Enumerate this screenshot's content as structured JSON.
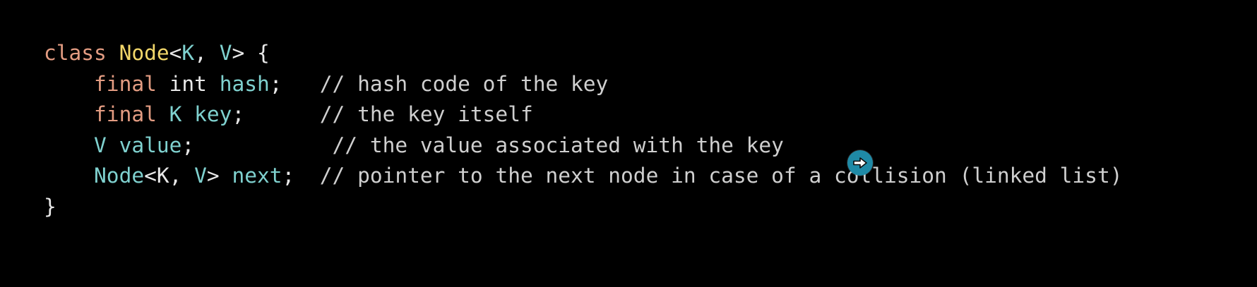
{
  "colors": {
    "background": "#000000",
    "keyword": "#e39c82",
    "type_name": "#f2d76a",
    "identifier": "#7fd1cf",
    "plain": "#e8e8e8",
    "comment": "#cfcfcf",
    "cursor": "#1f8aa6"
  },
  "code": {
    "line1": {
      "kw_class": "class",
      "sp1": " ",
      "type_node": "Node",
      "lt": "<",
      "param_k": "K",
      "comma": ", ",
      "param_v": "V",
      "gt_brace": "> {"
    },
    "line2": {
      "indent": "    ",
      "kw_final": "final",
      "sp1": " ",
      "type_int": "int",
      "sp2": " ",
      "field": "hash",
      "semi_pad": ";   ",
      "comment": "// hash code of the key"
    },
    "line3": {
      "indent": "    ",
      "kw_final": "final",
      "sp1": " ",
      "type_k": "K",
      "sp2": " ",
      "field": "key",
      "semi_pad": ";      ",
      "comment": "// the key itself"
    },
    "line4": {
      "indent": "    ",
      "type_v": "V",
      "sp1": " ",
      "field": "value",
      "semi_pad": ";           ",
      "comment": "// the value associated with the key"
    },
    "line5": {
      "indent": "    ",
      "type_node": "Node",
      "lt": "<",
      "param_k": "K",
      "comma": ", ",
      "param_v": "V",
      "gt_sp": "> ",
      "field": "next",
      "semi_pad": ";  ",
      "comment": "// pointer to the next node in case of a collision (linked list)"
    },
    "line6": {
      "close": "}"
    }
  },
  "cursor": {
    "icon": "arrow-right-icon"
  }
}
